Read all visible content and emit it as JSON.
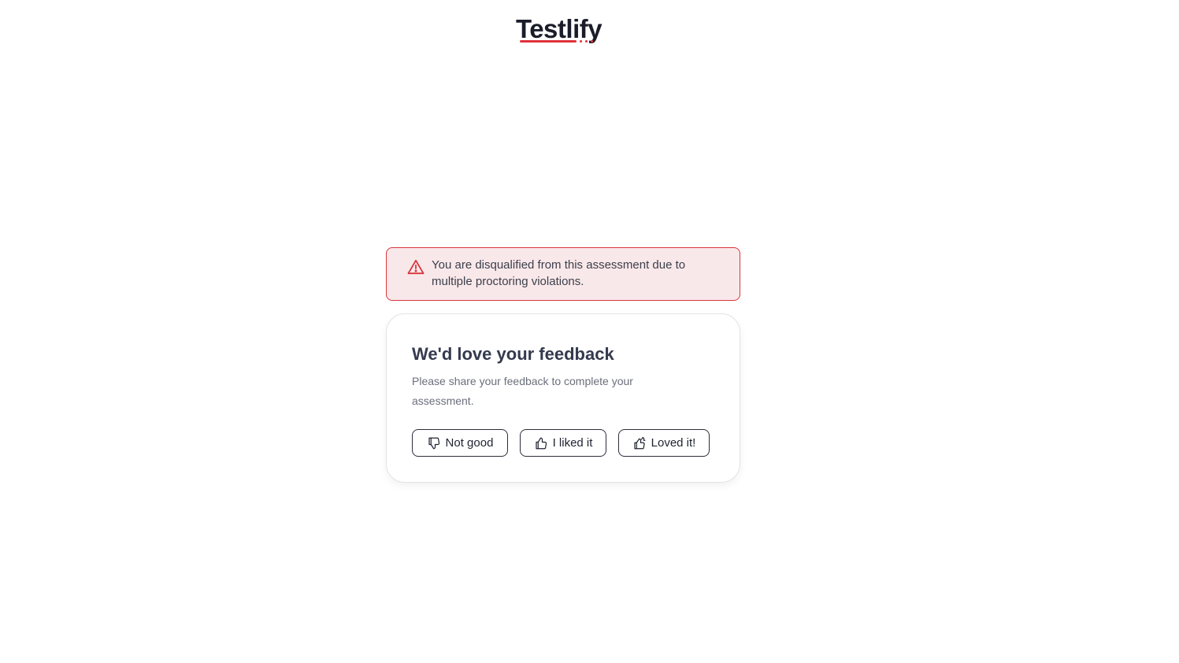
{
  "brand": {
    "name": "Testlify",
    "text_color": "#1a1d29",
    "accent_color": "#e0323c"
  },
  "alert": {
    "message": "You are disqualified from this assessment due to multiple proctoring violations.",
    "icon": "warning-triangle-icon",
    "border_color": "#d9363e",
    "background_color": "#f9e8ea"
  },
  "feedback": {
    "title": "We'd love your feedback",
    "subtitle": "Please share your feedback to complete your assessment.",
    "buttons": [
      {
        "label": "Not good",
        "icon": "thumbs-down-icon"
      },
      {
        "label": "I liked it",
        "icon": "thumbs-up-icon"
      },
      {
        "label": "Loved it!",
        "icon": "double-thumbs-up-icon"
      }
    ]
  }
}
